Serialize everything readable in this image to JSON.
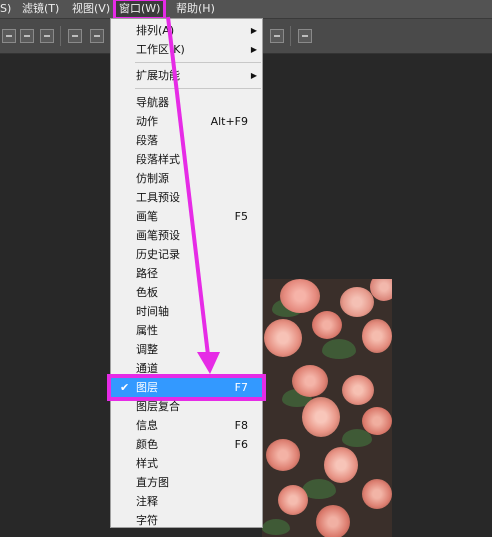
{
  "menubar": {
    "items": [
      "S)",
      "滤镜(T)",
      "视图(V)",
      "窗口(W)",
      "帮助(H)"
    ]
  },
  "window_menu": {
    "items": [
      {
        "label": "排列(A)",
        "submenu": true
      },
      {
        "label": "工作区(K)",
        "submenu": true
      },
      {
        "label": "扩展功能",
        "submenu": true
      },
      {
        "label": "导航器"
      },
      {
        "label": "动作",
        "shortcut": "Alt+F9"
      },
      {
        "label": "段落"
      },
      {
        "label": "段落样式"
      },
      {
        "label": "仿制源"
      },
      {
        "label": "工具预设"
      },
      {
        "label": "画笔",
        "shortcut": "F5"
      },
      {
        "label": "画笔预设"
      },
      {
        "label": "历史记录"
      },
      {
        "label": "路径"
      },
      {
        "label": "色板"
      },
      {
        "label": "时间轴"
      },
      {
        "label": "属性"
      },
      {
        "label": "调整"
      },
      {
        "label": "通道"
      },
      {
        "label": "图层",
        "shortcut": "F7",
        "checked": true,
        "highlighted": true
      },
      {
        "label": "图层复合"
      },
      {
        "label": "信息",
        "shortcut": "F8"
      },
      {
        "label": "颜色",
        "shortcut": "F6"
      },
      {
        "label": "样式"
      },
      {
        "label": "直方图"
      },
      {
        "label": "注释"
      },
      {
        "label": "字符"
      }
    ],
    "check_mark": "✔",
    "arrow_glyph": "▶"
  },
  "colors": {
    "highlight": "#3399ff",
    "annotation": "#e62be6"
  }
}
